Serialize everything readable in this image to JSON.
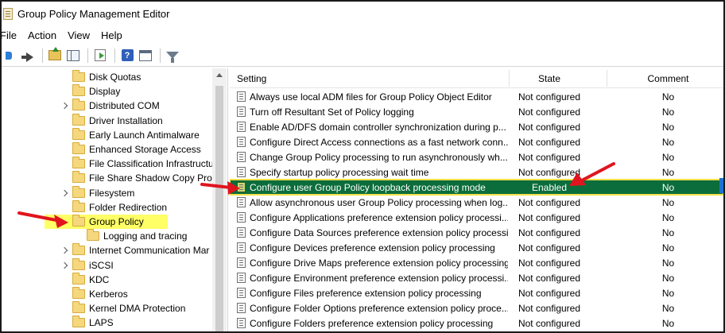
{
  "window": {
    "title": "Group Policy Management Editor"
  },
  "menu": [
    "File",
    "Action",
    "View",
    "Help"
  ],
  "toolbar": {
    "icons": [
      "back-icon",
      "forward-icon",
      "up-folder-icon",
      "show-hide-tree-icon",
      "export-list-icon",
      "help-icon",
      "properties-icon",
      "filter-icon"
    ]
  },
  "tree": {
    "items": [
      {
        "label": "Disk Quotas",
        "expandable": false,
        "indent": 1
      },
      {
        "label": "Display",
        "expandable": false,
        "indent": 1
      },
      {
        "label": "Distributed COM",
        "expandable": true,
        "indent": 1
      },
      {
        "label": "Driver Installation",
        "expandable": false,
        "indent": 1
      },
      {
        "label": "Early Launch Antimalware",
        "expandable": false,
        "indent": 1
      },
      {
        "label": "Enhanced Storage Access",
        "expandable": false,
        "indent": 1
      },
      {
        "label": "File Classification Infrastructu",
        "expandable": false,
        "indent": 1
      },
      {
        "label": "File Share Shadow Copy Provi",
        "expandable": false,
        "indent": 1
      },
      {
        "label": "Filesystem",
        "expandable": true,
        "indent": 1
      },
      {
        "label": "Folder Redirection",
        "expandable": false,
        "indent": 1
      },
      {
        "label": "Group Policy",
        "expandable": false,
        "indent": 1,
        "selected": true
      },
      {
        "label": "Logging and tracing",
        "expandable": false,
        "indent": 2
      },
      {
        "label": "Internet Communication Mar",
        "expandable": true,
        "indent": 1
      },
      {
        "label": "iSCSI",
        "expandable": true,
        "indent": 1
      },
      {
        "label": "KDC",
        "expandable": false,
        "indent": 1
      },
      {
        "label": "Kerberos",
        "expandable": false,
        "indent": 1
      },
      {
        "label": "Kernel DMA Protection",
        "expandable": false,
        "indent": 1
      },
      {
        "label": "LAPS",
        "expandable": false,
        "indent": 1
      }
    ]
  },
  "list": {
    "columns": {
      "setting": "Setting",
      "state": "State",
      "comment": "Comment"
    },
    "rows": [
      {
        "setting": "Always use local ADM files for Group Policy Object Editor",
        "state": "Not configured",
        "comment": "No"
      },
      {
        "setting": "Turn off Resultant Set of Policy logging",
        "state": "Not configured",
        "comment": "No"
      },
      {
        "setting": "Enable AD/DFS domain controller synchronization during p...",
        "state": "Not configured",
        "comment": "No"
      },
      {
        "setting": "Configure Direct Access connections as a fast network conn...",
        "state": "Not configured",
        "comment": "No"
      },
      {
        "setting": "Change Group Policy processing to run asynchronously wh...",
        "state": "Not configured",
        "comment": "No"
      },
      {
        "setting": "Specify startup policy processing wait time",
        "state": "Not configured",
        "comment": "No"
      },
      {
        "setting": "Configure user Group Policy loopback processing mode",
        "state": "Enabled",
        "comment": "No",
        "highlight": true
      },
      {
        "setting": "Allow asynchronous user Group Policy processing when log...",
        "state": "Not configured",
        "comment": "No"
      },
      {
        "setting": "Configure Applications preference extension policy processi...",
        "state": "Not configured",
        "comment": "No"
      },
      {
        "setting": "Configure Data Sources preference extension policy processi...",
        "state": "Not configured",
        "comment": "No"
      },
      {
        "setting": "Configure Devices preference extension policy processing",
        "state": "Not configured",
        "comment": "No"
      },
      {
        "setting": "Configure Drive Maps preference extension policy processing",
        "state": "Not configured",
        "comment": "No"
      },
      {
        "setting": "Configure Environment preference extension policy processi...",
        "state": "Not configured",
        "comment": "No"
      },
      {
        "setting": "Configure Files preference extension policy processing",
        "state": "Not configured",
        "comment": "No"
      },
      {
        "setting": "Configure Folder Options preference extension policy proce...",
        "state": "Not configured",
        "comment": "No"
      },
      {
        "setting": "Configure Folders preference extension policy processing",
        "state": "Not configured",
        "comment": "No"
      }
    ]
  },
  "colors": {
    "highlight_row": "#0b6d3b",
    "highlight_outline": "#f3e04a",
    "selected_tree": "#ffff66",
    "callout_arrow": "#e0141e"
  }
}
